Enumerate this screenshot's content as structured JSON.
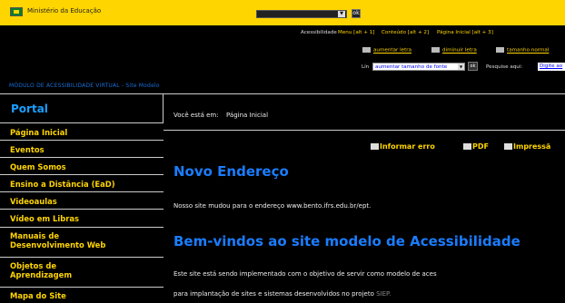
{
  "gov_bar": {
    "name": "Ministério da Educação",
    "select_value": "",
    "go_label": "ok"
  },
  "accessibility": {
    "label": "Acessibilidade",
    "links": [
      "Menu [alt + 1]",
      "Conteúdo [alt + 2]",
      "Página Inicial [alt + 3]"
    ],
    "font_controls": [
      "aumentar letra",
      "diminuir letra",
      "tamanho normal"
    ]
  },
  "language": {
    "label": "Lín",
    "select_value": "aumentar tamanho de fonte",
    "go_label": "ok",
    "search_label": "Pesquise aqui:",
    "search_value": "Digite ao"
  },
  "module_title": "MÓDULO DE ACESSIBILIDADE VIRTUAL - Site Modelo",
  "sidebar": {
    "title": "Portal",
    "items": [
      {
        "label": "Página Inicial"
      },
      {
        "label": "Eventos"
      },
      {
        "label": "Quem Somos"
      },
      {
        "label": "Ensino a Distância (EaD)"
      },
      {
        "label": "Videoaulas"
      },
      {
        "label": "Vídeo em Libras"
      },
      {
        "label": "Manuais de"
      },
      {
        "label": "Desenvolvimento Web"
      },
      {
        "label": "Objetos de"
      },
      {
        "label": "Aprendizagem"
      },
      {
        "label": "Mapa do Site"
      }
    ]
  },
  "breadcrumb": {
    "label": "Você está em:",
    "current": "Página Inicial"
  },
  "tools": {
    "report": "Informar erro",
    "pdf": "PDF",
    "print": "Impressã"
  },
  "content": {
    "heading1": "Novo Endereço",
    "para1": "Nosso site mudou para o endereço www.bento.ifrs.edu.br/ept.",
    "heading2": "Bem-vindos ao site modelo de Acessibilidade",
    "para2": "Este site está sendo implementado com o objetivo de servir como modelo de aces",
    "para3": "para implantação de sites e sistemas desenvolvidos no projeto",
    "para3_link": "SIEP."
  }
}
